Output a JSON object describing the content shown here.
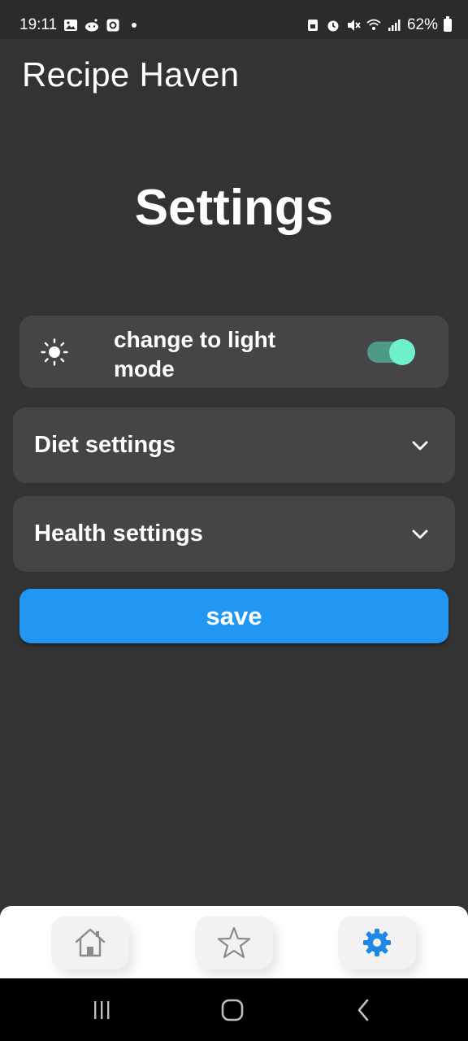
{
  "status_bar": {
    "time": "19:11",
    "battery_percent": "62%"
  },
  "app": {
    "title": "Recipe Haven"
  },
  "page": {
    "title": "Settings"
  },
  "theme_toggle": {
    "label": "change to light mode",
    "enabled": true,
    "icon": "sun-icon"
  },
  "accordions": [
    {
      "label": "Diet settings",
      "icon": "chevron-down-icon"
    },
    {
      "label": "Health settings",
      "icon": "chevron-down-icon"
    }
  ],
  "save_button": {
    "label": "save"
  },
  "bottom_nav": {
    "items": [
      {
        "name": "home",
        "icon": "home-icon",
        "active": false
      },
      {
        "name": "favorites",
        "icon": "star-icon",
        "active": false
      },
      {
        "name": "settings",
        "icon": "gear-icon",
        "active": true
      }
    ]
  },
  "colors": {
    "background": "#333333",
    "card": "#454545",
    "accent": "#2196f3",
    "toggle_track": "#4f9a86",
    "toggle_knob": "#6ef0cc"
  }
}
